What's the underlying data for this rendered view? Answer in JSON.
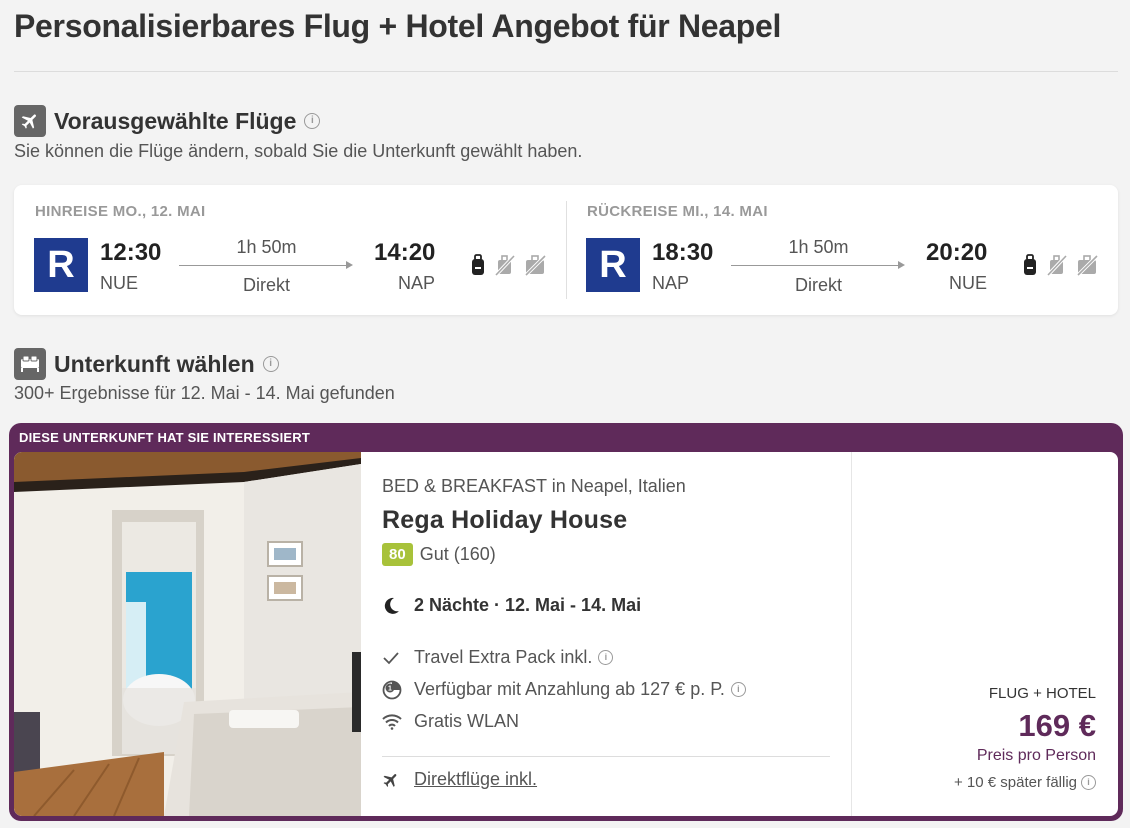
{
  "page": {
    "title": "Personalisierbares Flug + Hotel Angebot für Neapel"
  },
  "flights_section": {
    "title": "Vorausgewählte Flüge",
    "subtitle": "Sie können die Flüge ändern, sobald Sie die Unterkunft gewählt haben.",
    "icon": "airplane-icon",
    "legs": [
      {
        "label": "HINREISE MO., 12. MAI",
        "airline_code": "R",
        "dep_time": "12:30",
        "dep_code": "NUE",
        "duration": "1h 50m",
        "stops": "Direkt",
        "arr_time": "14:20",
        "arr_code": "NAP"
      },
      {
        "label": "RÜCKREISE MI., 14. MAI",
        "airline_code": "R",
        "dep_time": "18:30",
        "dep_code": "NAP",
        "duration": "1h 50m",
        "stops": "Direkt",
        "arr_time": "20:20",
        "arr_code": "NUE"
      }
    ]
  },
  "accommodation_section": {
    "title": "Unterkunft wählen",
    "subtitle": "300+ Ergebnisse für 12. Mai - 14. Mai gefunden",
    "icon": "bed-icon"
  },
  "promo": {
    "label": "DIESE UNTERKUNFT HAT SIE INTERESSIERT",
    "hotel": {
      "type": "BED & BREAKFAST in Neapel, Italien",
      "name": "Rega Holiday House",
      "rating_score": "80",
      "rating_text": "Gut (160)",
      "nights": "2 Nächte · 12. Mai - 14. Mai",
      "features": [
        {
          "icon": "check-icon",
          "text": "Travel Extra Pack inkl."
        },
        {
          "icon": "deposit-icon",
          "text": "Verfügbar mit Anzahlung ab 127 € p. P."
        },
        {
          "icon": "wifi-icon",
          "text": "Gratis WLAN"
        }
      ],
      "direct_flights": "Direktflüge inkl.",
      "price_type": "FLUG + HOTEL",
      "price": "169 €",
      "price_per": "Preis pro Person",
      "price_later": "+ 10 € später fällig"
    }
  },
  "colors": {
    "accent": "#5f2a5a",
    "airline": "#1f3b8f",
    "rating": "#a8c23a"
  }
}
